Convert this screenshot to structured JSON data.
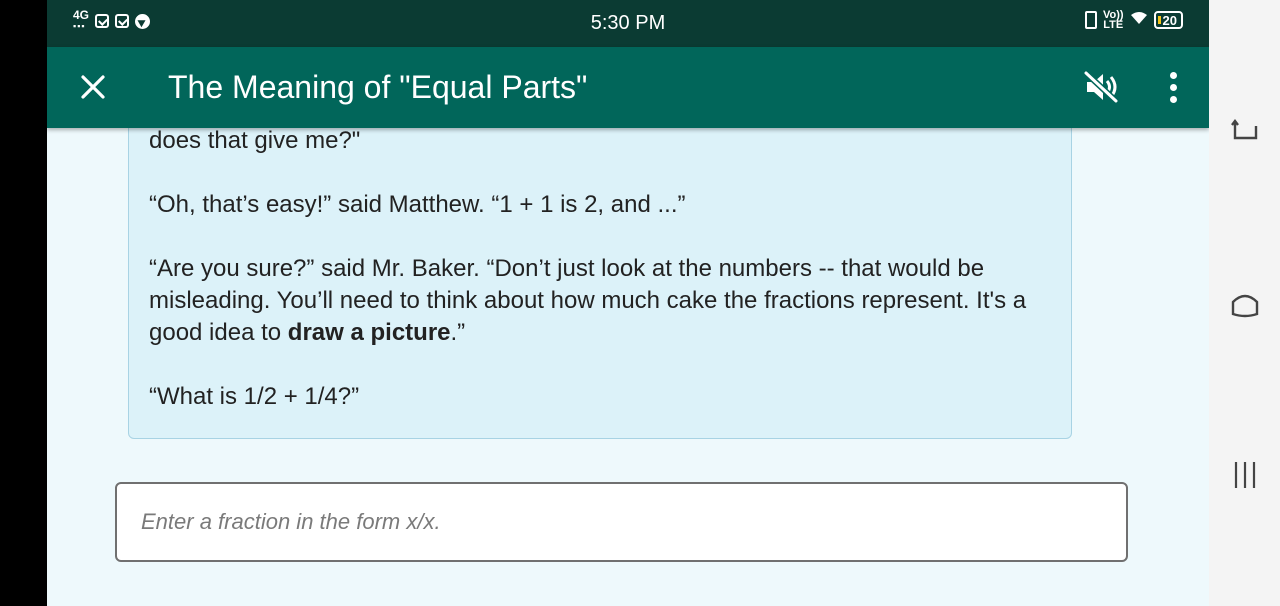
{
  "status_bar": {
    "network": "4G",
    "time": "5:30 PM",
    "lte_top": "Vo))",
    "lte_bottom": "LTE",
    "battery": "20"
  },
  "header": {
    "title": "The Meaning of \"Equal Parts\""
  },
  "story": {
    "line1": "does that give me?\"",
    "line2": "“Oh, that’s easy!” said Matthew. “1 + 1 is 2, and ...”",
    "line3_before": "“Are you sure?” said Mr. Baker. “Don’t just look at the numbers -- that would be misleading. You’ll need to think about how much cake the fractions represent. It's a good idea to ",
    "line3_bold": "draw a picture",
    "line3_after": ".”",
    "line4": "“What is 1/2 + 1/4?”"
  },
  "answer": {
    "placeholder": "Enter a fraction in the form x/x.",
    "value": ""
  },
  "colors": {
    "status_bar": "#0b3b33",
    "app_bar": "#01665a",
    "card_background": "#dcf2f9",
    "page_background": "#eef9fc"
  },
  "icons": {
    "close": "close-icon",
    "mute": "volume-off-icon",
    "more": "more-vert-icon",
    "rotate": "rotate-icon",
    "home": "home-icon",
    "recents": "recents-icon"
  }
}
